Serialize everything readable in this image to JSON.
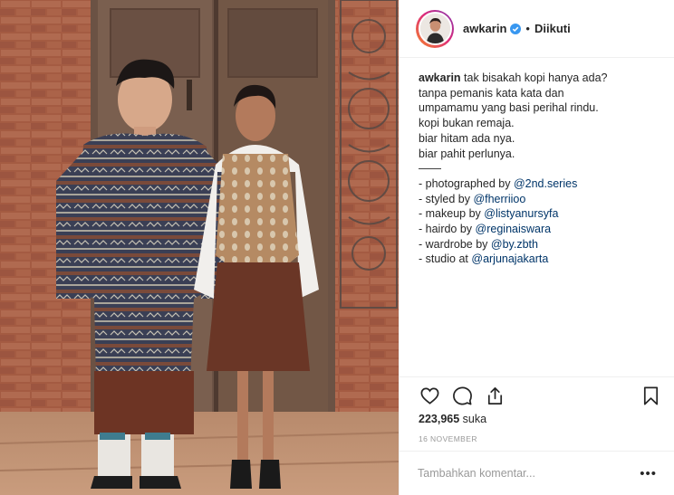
{
  "post": {
    "photo_alt": "",
    "icons": {
      "like": "heart-icon",
      "comment": "comment-icon",
      "share": "share-icon",
      "save": "bookmark-icon",
      "verified": "verified-badge-icon",
      "options": "more-options-icon"
    },
    "colors": {
      "verified": "#3897f0",
      "link": "#003569",
      "muted": "#999999",
      "text": "#262626"
    }
  },
  "header": {
    "username": "awkarin",
    "separator": "•",
    "follow_state": "Diikuti"
  },
  "caption": {
    "username": "awkarin",
    "lines": [
      "tak bisakah kopi hanya ada?",
      "tanpa pemanis kata kata dan",
      "umpamamu yang basi perihal rindu.",
      "kopi bukan remaja.",
      "biar hitam ada nya.",
      "biar pahit perlunya.",
      "——"
    ],
    "credits": [
      {
        "label": "- photographed by ",
        "handle": "@2nd.series"
      },
      {
        "label": "- styled by ",
        "handle": "@fherriioo"
      },
      {
        "label": "- makeup by ",
        "handle": "@listyanursyfa"
      },
      {
        "label": "- hairdo by ",
        "handle": "@reginaiswara"
      },
      {
        "label": "- wardrobe by ",
        "handle": "@by.zbth"
      },
      {
        "label": "- studio at ",
        "handle": "@arjunajakarta"
      }
    ]
  },
  "stats": {
    "likes_count": "223,965",
    "likes_label": "suka",
    "date": "16 NOVEMBER"
  },
  "comment": {
    "placeholder": "Tambahkan komentar...",
    "more": "•••"
  }
}
